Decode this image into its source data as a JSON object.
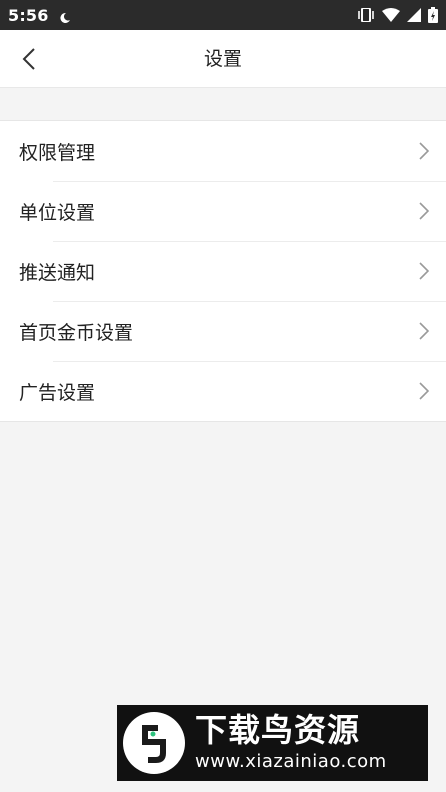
{
  "status_bar": {
    "time": "5:56",
    "icons": [
      "moon-icon",
      "vibrate-icon",
      "wifi-icon",
      "signal-icon",
      "battery-icon"
    ]
  },
  "header": {
    "title": "设置",
    "back_icon": "chevron-left-icon"
  },
  "settings": {
    "items": [
      {
        "label": "权限管理"
      },
      {
        "label": "单位设置"
      },
      {
        "label": "推送通知"
      },
      {
        "label": "首页金币设置"
      },
      {
        "label": "广告设置"
      }
    ],
    "item_icon": "chevron-right-icon"
  },
  "watermark": {
    "title": "下载鸟资源",
    "url": "www.xiazainiao.com"
  },
  "colors": {
    "status_bar_bg": "#2b2b2b",
    "page_bg": "#f4f4f4",
    "row_bg": "#ffffff",
    "chevron": "#9a9a9a"
  }
}
